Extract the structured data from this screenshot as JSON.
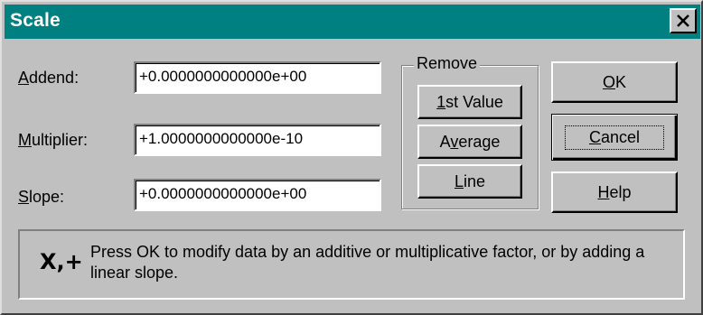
{
  "window": {
    "title": "Scale",
    "close_glyph": "✕"
  },
  "fields": {
    "addend": {
      "label_mnemonic": "A",
      "label_rest": "ddend:",
      "value": "+0.0000000000000e+00"
    },
    "multiplier": {
      "label_mnemonic": "M",
      "label_rest": "ultiplier:",
      "value": "+1.0000000000000e-10"
    },
    "slope": {
      "label_mnemonic": "S",
      "label_rest": "lope:",
      "value": "+0.0000000000000e+00"
    }
  },
  "remove_group": {
    "legend": "Remove",
    "first_value": {
      "mnemonic": "1",
      "rest": "st Value"
    },
    "average": {
      "pre": "A",
      "mnemonic": "v",
      "rest": "erage"
    },
    "line": {
      "mnemonic": "L",
      "rest": "ine"
    }
  },
  "buttons": {
    "ok": {
      "mnemonic": "O",
      "rest": "K"
    },
    "cancel": {
      "mnemonic": "C",
      "rest": "ancel"
    },
    "help": {
      "mnemonic": "H",
      "rest": "elp"
    }
  },
  "info": {
    "icon_text": "X,+",
    "message": "Press OK to modify data by an additive or multiplicative factor, or by adding a linear slope."
  },
  "colors": {
    "titlebar": "#008080",
    "face": "#c0c0c0"
  }
}
